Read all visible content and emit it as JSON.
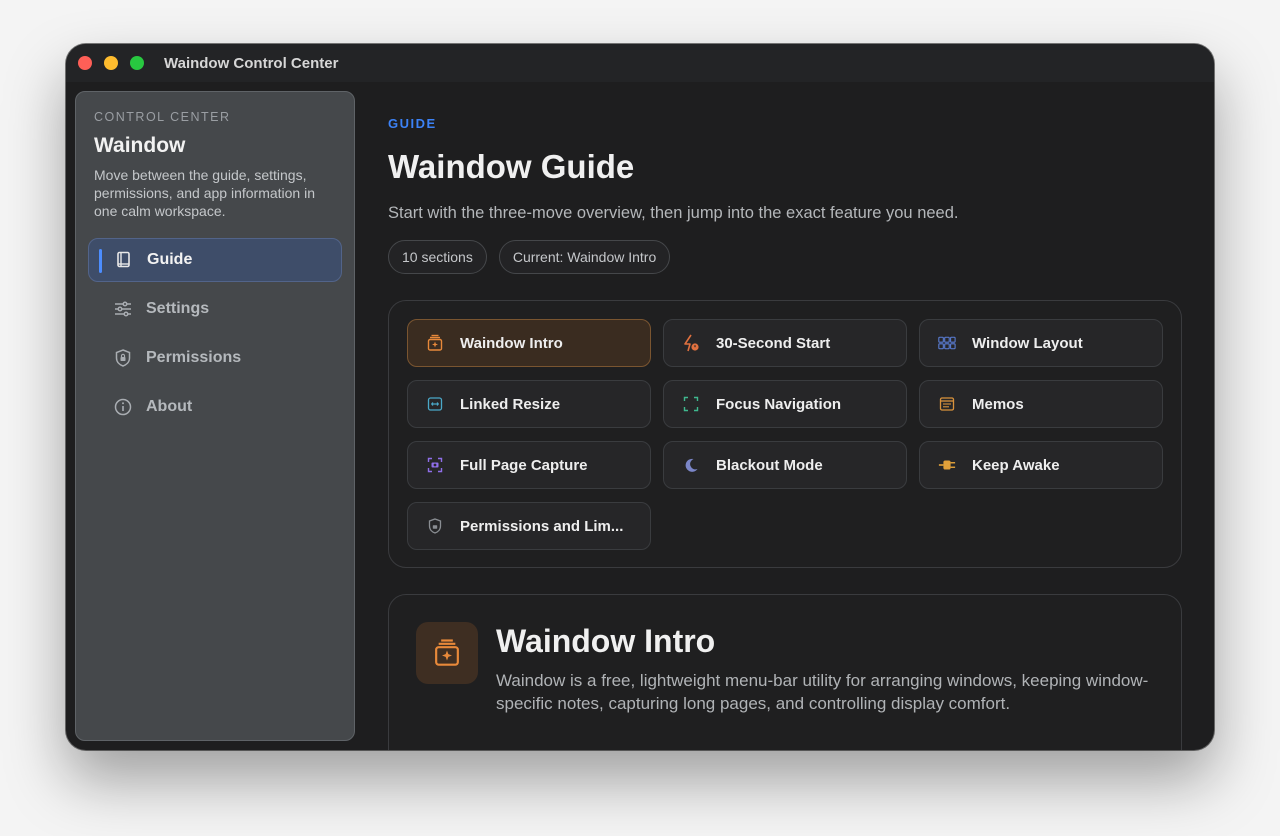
{
  "window": {
    "title": "Waindow Control Center"
  },
  "sidebar": {
    "eyebrow": "CONTROL CENTER",
    "title": "Waindow",
    "description": "Move between the guide, settings, permissions, and app information in one calm workspace.",
    "items": [
      {
        "label": "Guide",
        "icon": "book-icon",
        "active": true
      },
      {
        "label": "Settings",
        "icon": "sliders-icon",
        "active": false
      },
      {
        "label": "Permissions",
        "icon": "shield-icon",
        "active": false
      },
      {
        "label": "About",
        "icon": "info-icon",
        "active": false
      }
    ]
  },
  "main": {
    "eyebrow": "GUIDE",
    "title": "Waindow Guide",
    "subtitle": "Start with the three-move overview, then jump into the exact feature you need.",
    "chips": [
      "10 sections",
      "Current: Waindow Intro"
    ],
    "sections": [
      {
        "label": "Waindow Intro",
        "icon": "sparkle-box-icon",
        "active": true
      },
      {
        "label": "30-Second Start",
        "icon": "bolt-timer-icon",
        "active": false
      },
      {
        "label": "Window Layout",
        "icon": "grid-layout-icon",
        "active": false
      },
      {
        "label": "Linked Resize",
        "icon": "resize-arrows-icon",
        "active": false
      },
      {
        "label": "Focus Navigation",
        "icon": "focus-frame-icon",
        "active": false
      },
      {
        "label": "Memos",
        "icon": "note-icon",
        "active": false
      },
      {
        "label": "Full Page Capture",
        "icon": "capture-icon",
        "active": false
      },
      {
        "label": "Blackout Mode",
        "icon": "moon-icon",
        "active": false
      },
      {
        "label": "Keep Awake",
        "icon": "plug-icon",
        "active": false
      },
      {
        "label": "Permissions and Lim...",
        "icon": "lock-shield-icon",
        "active": false
      }
    ],
    "detail": {
      "title": "Waindow Intro",
      "body": "Waindow is a free, lightweight menu-bar utility for arranging windows, keeping window-specific notes, capturing long pages, and controlling display comfort.",
      "icon": "sparkle-box-icon"
    }
  },
  "colors": {
    "accent": "#3c82f6",
    "active_tile": "#3a2c20",
    "orange": "#e8893a"
  }
}
